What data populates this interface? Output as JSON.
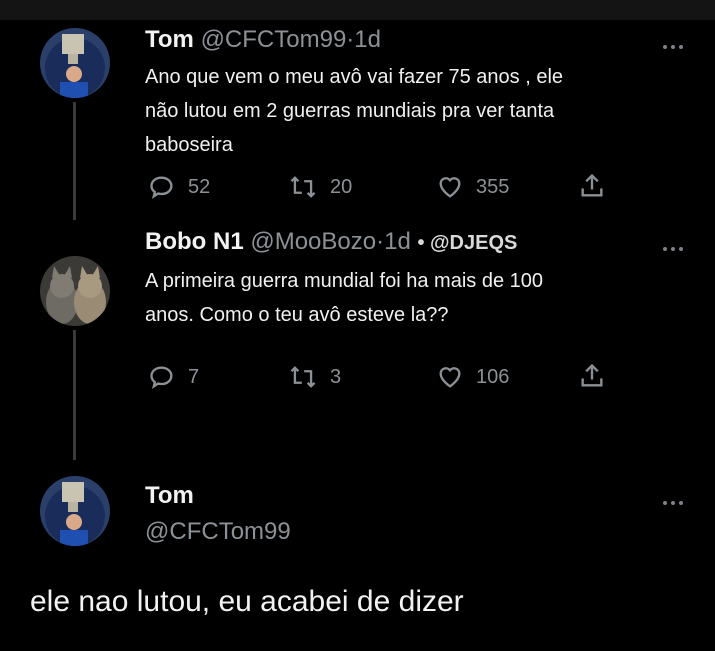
{
  "tweets": [
    {
      "name": "Tom",
      "handle": "@CFCTom99",
      "separator": "·",
      "time": "1d",
      "text_lines": [
        "Ano que vem o meu avô vai fazer 75 anos , ele",
        "não lutou em 2 guerras mundiais pra ver tanta",
        "baboseira"
      ],
      "replies": "52",
      "retweets": "20",
      "likes": "355"
    },
    {
      "name": "Bobo N1",
      "handle": "@MooBozo",
      "separator": "·",
      "time": "1d",
      "badge": "• @DJEQS",
      "text_lines": [
        "A primeira guerra mundial foi  ha mais de 100",
        "anos. Como o teu avô esteve la??"
      ],
      "replies": "7",
      "retweets": "3",
      "likes": "106"
    }
  ],
  "focused": {
    "name": "Tom",
    "handle": "@CFCTom99",
    "text": "ele nao lutou, eu acabei de dizer"
  },
  "icons": {
    "more": "more-horizontal-icon",
    "reply": "reply-icon",
    "retweet": "retweet-icon",
    "like": "heart-icon",
    "share": "share-icon"
  },
  "colors": {
    "background": "#000000",
    "muted": "#8b9196",
    "thread_line": "#3a3a3a"
  }
}
